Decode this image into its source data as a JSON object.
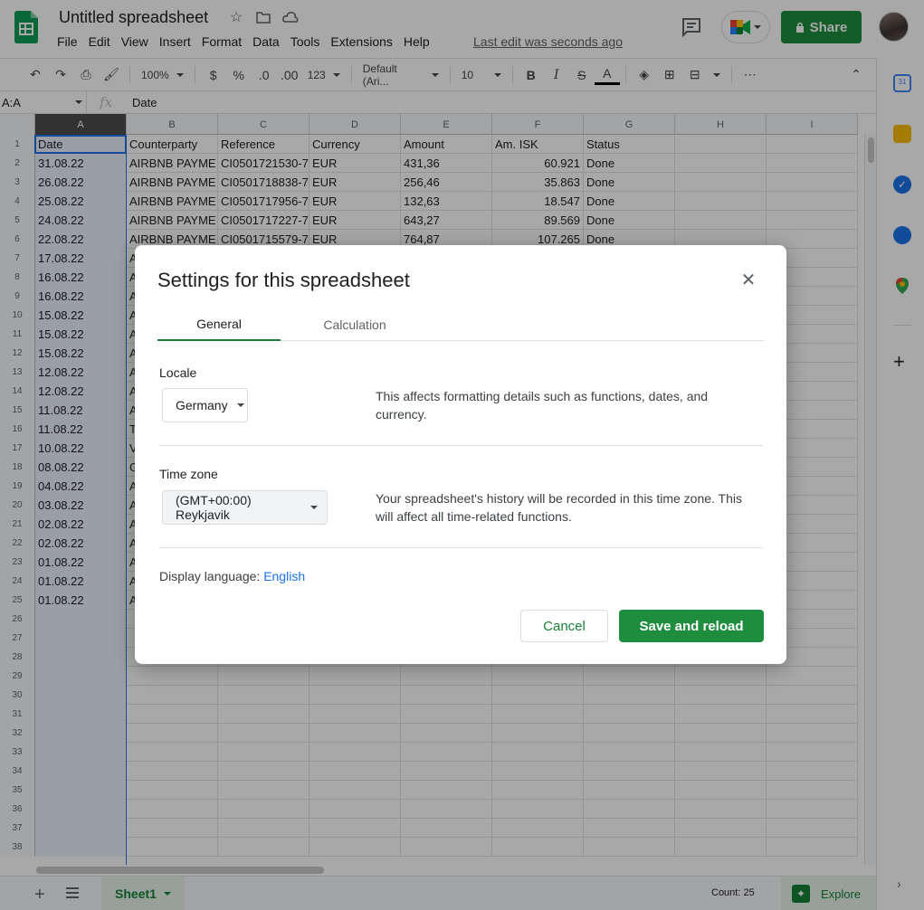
{
  "app": {
    "title": "Untitled spreadsheet",
    "last_edit": "Last edit was seconds ago",
    "share_label": "Share",
    "menu": [
      "File",
      "Edit",
      "View",
      "Insert",
      "Format",
      "Data",
      "Tools",
      "Extensions",
      "Help"
    ]
  },
  "toolbar": {
    "zoom": "100%",
    "currency": "$",
    "percent": "%",
    "decrease_decimal": ".0",
    "increase_decimal": ".00",
    "number_format": "123",
    "font": "Default (Ari...",
    "font_size": "10",
    "bold": "B",
    "italic": "I",
    "strike": "S",
    "text_color": "A",
    "more": "⋯"
  },
  "formula_bar": {
    "name_box": "A:A",
    "fx": "fx",
    "value": "Date"
  },
  "grid": {
    "columns": [
      "A",
      "B",
      "C",
      "D",
      "E",
      "F",
      "G",
      "H",
      "I"
    ],
    "rows": [
      {
        "n": "1",
        "cells": [
          "Date",
          "Counterparty",
          "Reference",
          "Currency",
          "Amount",
          "Am. ISK",
          "Status",
          "",
          ""
        ]
      },
      {
        "n": "2",
        "cells": [
          "31.08.22",
          "AIRBNB PAYME",
          "CI0501721530-7",
          "EUR",
          "431,36",
          "60.921",
          "Done",
          "",
          ""
        ]
      },
      {
        "n": "3",
        "cells": [
          "26.08.22",
          "AIRBNB PAYME",
          "CI0501718838-7",
          "EUR",
          "256,46",
          "35.863",
          "Done",
          "",
          ""
        ]
      },
      {
        "n": "4",
        "cells": [
          "25.08.22",
          "AIRBNB PAYME",
          "CI0501717956-7",
          "EUR",
          "132,63",
          "18.547",
          "Done",
          "",
          ""
        ]
      },
      {
        "n": "5",
        "cells": [
          "24.08.22",
          "AIRBNB PAYME",
          "CI0501717227-7",
          "EUR",
          "643,27",
          "89.569",
          "Done",
          "",
          ""
        ]
      },
      {
        "n": "6",
        "cells": [
          "22.08.22",
          "AIRBNB PAYME",
          "CI0501715579-7",
          "EUR",
          "764,87",
          "107.265",
          "Done",
          "",
          ""
        ]
      },
      {
        "n": "7",
        "cells": [
          "17.08.22",
          "A",
          "",
          "",
          "",
          "",
          "",
          "",
          ""
        ]
      },
      {
        "n": "8",
        "cells": [
          "16.08.22",
          "A",
          "",
          "",
          "",
          "",
          "",
          "",
          ""
        ]
      },
      {
        "n": "9",
        "cells": [
          "16.08.22",
          "A",
          "",
          "",
          "",
          "",
          "",
          "",
          ""
        ]
      },
      {
        "n": "10",
        "cells": [
          "15.08.22",
          "A",
          "",
          "",
          "",
          "",
          "",
          "",
          ""
        ]
      },
      {
        "n": "11",
        "cells": [
          "15.08.22",
          "A",
          "",
          "",
          "",
          "",
          "",
          "",
          ""
        ]
      },
      {
        "n": "12",
        "cells": [
          "15.08.22",
          "A",
          "",
          "",
          "",
          "",
          "",
          "",
          ""
        ]
      },
      {
        "n": "13",
        "cells": [
          "12.08.22",
          "A",
          "",
          "",
          "",
          "",
          "",
          "",
          ""
        ]
      },
      {
        "n": "14",
        "cells": [
          "12.08.22",
          "A",
          "",
          "",
          "",
          "",
          "",
          "",
          ""
        ]
      },
      {
        "n": "15",
        "cells": [
          "11.08.22",
          "A",
          "",
          "",
          "",
          "",
          "",
          "",
          ""
        ]
      },
      {
        "n": "16",
        "cells": [
          "11.08.22",
          "T",
          "",
          "",
          "",
          "",
          "",
          "",
          ""
        ]
      },
      {
        "n": "17",
        "cells": [
          "10.08.22",
          "V",
          "",
          "",
          "",
          "",
          "",
          "",
          ""
        ]
      },
      {
        "n": "18",
        "cells": [
          "08.08.22",
          "G",
          "",
          "",
          "",
          "",
          "",
          "",
          ""
        ]
      },
      {
        "n": "19",
        "cells": [
          "04.08.22",
          "A",
          "",
          "",
          "",
          "",
          "",
          "",
          ""
        ]
      },
      {
        "n": "20",
        "cells": [
          "03.08.22",
          "A",
          "",
          "",
          "",
          "",
          "",
          "",
          ""
        ]
      },
      {
        "n": "21",
        "cells": [
          "02.08.22",
          "A",
          "",
          "",
          "",
          "",
          "",
          "",
          ""
        ]
      },
      {
        "n": "22",
        "cells": [
          "02.08.22",
          "A",
          "",
          "",
          "",
          "",
          "",
          "",
          ""
        ]
      },
      {
        "n": "23",
        "cells": [
          "01.08.22",
          "A",
          "",
          "",
          "",
          "",
          "",
          "",
          ""
        ]
      },
      {
        "n": "24",
        "cells": [
          "01.08.22",
          "A",
          "",
          "",
          "",
          "",
          "",
          "",
          ""
        ]
      },
      {
        "n": "25",
        "cells": [
          "01.08.22",
          "A",
          "",
          "",
          "",
          "",
          "",
          "",
          ""
        ]
      },
      {
        "n": "26",
        "cells": [
          "",
          "",
          "",
          "",
          "",
          "",
          "",
          "",
          ""
        ]
      },
      {
        "n": "27",
        "cells": [
          "",
          "",
          "",
          "",
          "",
          "",
          "",
          "",
          ""
        ]
      },
      {
        "n": "28",
        "cells": [
          "",
          "",
          "",
          "",
          "",
          "",
          "",
          "",
          ""
        ]
      },
      {
        "n": "29",
        "cells": [
          "",
          "",
          "",
          "",
          "",
          "",
          "",
          "",
          ""
        ]
      },
      {
        "n": "30",
        "cells": [
          "",
          "",
          "",
          "",
          "",
          "",
          "",
          "",
          ""
        ]
      },
      {
        "n": "31",
        "cells": [
          "",
          "",
          "",
          "",
          "",
          "",
          "",
          "",
          ""
        ]
      },
      {
        "n": "32",
        "cells": [
          "",
          "",
          "",
          "",
          "",
          "",
          "",
          "",
          ""
        ]
      },
      {
        "n": "33",
        "cells": [
          "",
          "",
          "",
          "",
          "",
          "",
          "",
          "",
          ""
        ]
      },
      {
        "n": "34",
        "cells": [
          "",
          "",
          "",
          "",
          "",
          "",
          "",
          "",
          ""
        ]
      },
      {
        "n": "35",
        "cells": [
          "",
          "",
          "",
          "",
          "",
          "",
          "",
          "",
          ""
        ]
      },
      {
        "n": "36",
        "cells": [
          "",
          "",
          "",
          "",
          "",
          "",
          "",
          "",
          ""
        ]
      },
      {
        "n": "37",
        "cells": [
          "",
          "",
          "",
          "",
          "",
          "",
          "",
          "",
          ""
        ]
      },
      {
        "n": "38",
        "cells": [
          "",
          "",
          "",
          "",
          "",
          "",
          "",
          "",
          ""
        ]
      }
    ]
  },
  "bottom": {
    "sheet_name": "Sheet1",
    "count": "Count: 25",
    "explore": "Explore"
  },
  "dialog": {
    "title": "Settings for this spreadsheet",
    "tabs": [
      "General",
      "Calculation"
    ],
    "locale_label": "Locale",
    "locale_value": "Germany",
    "locale_help": "This affects formatting details such as functions, dates, and currency.",
    "timezone_label": "Time zone",
    "timezone_value": "(GMT+00:00) Reykjavik",
    "timezone_help": "Your spreadsheet's history will be recorded in this time zone. This will affect all time-related functions.",
    "display_language_label": "Display language:",
    "display_language_value": "English",
    "cancel_label": "Cancel",
    "save_label": "Save and reload"
  },
  "colors": {
    "brand_green": "#1e8e3e",
    "selection_blue": "#1a73e8",
    "link_blue": "#1a73e8"
  }
}
